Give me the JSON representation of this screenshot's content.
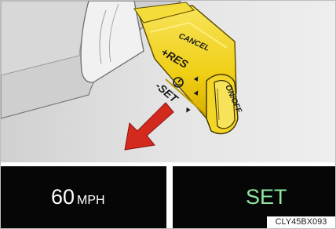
{
  "lever": {
    "cancel": "CANCEL",
    "res": "+RES",
    "set": "-SET",
    "onoff": "ON/OFF",
    "arrow_up": "▲",
    "arrow_down": "▼"
  },
  "display": {
    "speed_value": "60",
    "speed_unit": "MPH",
    "status": "SET"
  },
  "figure_code": "CLY45BX093",
  "colors": {
    "lever": "#f2d21b",
    "arrow": "#d42a1e",
    "set_text": "#8fe7a0",
    "panel_bg": "#060606"
  },
  "icons": [
    "cruise-control-icon",
    "down-arrow-icon"
  ]
}
